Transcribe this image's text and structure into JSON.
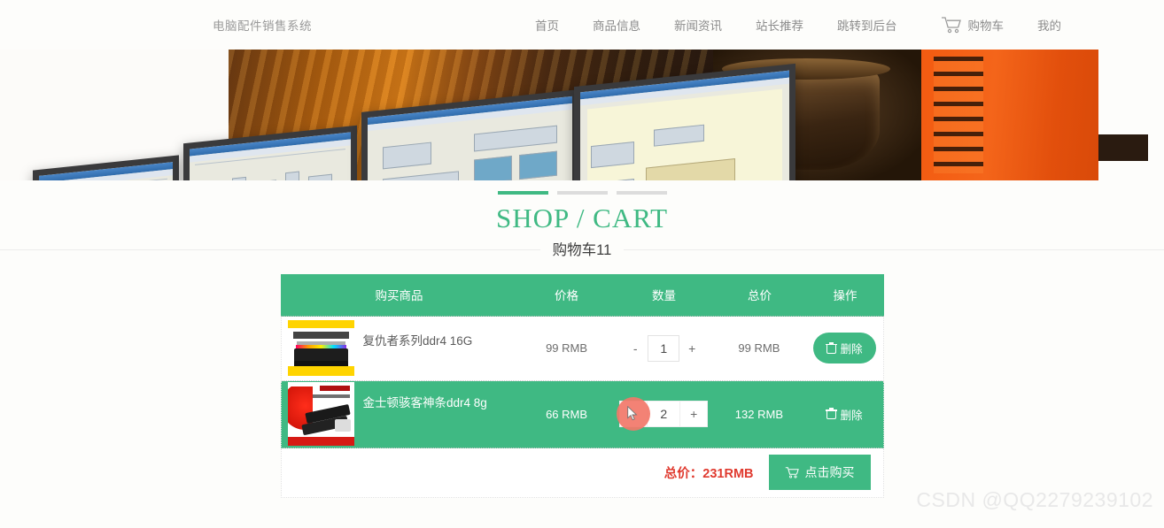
{
  "nav": {
    "brand": "电脑配件销售系统",
    "links": [
      {
        "label": "首页",
        "name": "nav-home"
      },
      {
        "label": "商品信息",
        "name": "nav-products"
      },
      {
        "label": "新闻资讯",
        "name": "nav-news"
      },
      {
        "label": "站长推荐",
        "name": "nav-recommend"
      },
      {
        "label": "跳转到后台",
        "name": "nav-admin"
      },
      {
        "label": "购物车",
        "name": "nav-cart"
      },
      {
        "label": "我的",
        "name": "nav-mine"
      }
    ]
  },
  "page": {
    "title_en": "SHOP / CART",
    "title_cn": "购物车11"
  },
  "table": {
    "headers": {
      "product": "购买商品",
      "price": "价格",
      "quantity": "数量",
      "total": "总价",
      "action": "操作"
    },
    "rows": [
      {
        "name": "复仇者系列ddr4 16G",
        "price": "99 RMB",
        "minus": "-",
        "qty": "1",
        "plus": "+",
        "total": "99 RMB",
        "delete_label": "删除"
      },
      {
        "name": "金士顿骇客神条ddr4 8g",
        "price": "66 RMB",
        "minus": "-",
        "qty": "2",
        "plus": "+",
        "total": "132 RMB",
        "delete_label": "删除"
      }
    ]
  },
  "summary": {
    "total_label": "总价：",
    "total_value": "231RMB",
    "buy_label": "点击购买"
  },
  "watermark": "CSDN @QQ2279239102",
  "colors": {
    "brand_green": "#3fb983",
    "total_red": "#e03a2f",
    "cursor_highlight": "#f2786a"
  }
}
